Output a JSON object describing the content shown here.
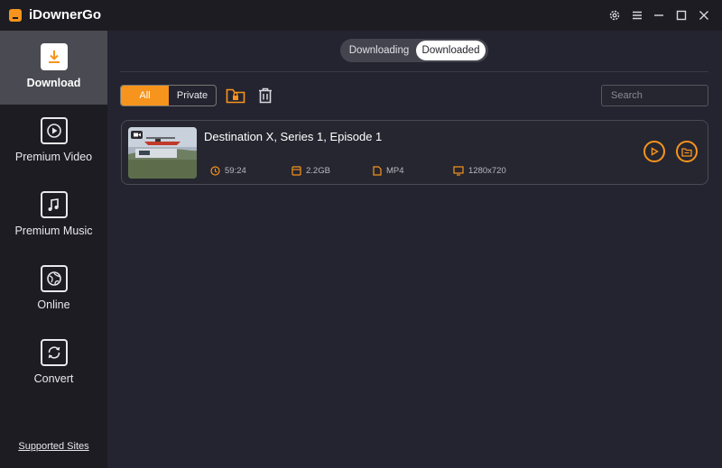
{
  "app": {
    "title": "iDownerGo"
  },
  "sidebar": {
    "items": [
      {
        "label": "Download",
        "icon": "download-icon",
        "active": true
      },
      {
        "label": "Premium Video",
        "icon": "play-icon",
        "active": false
      },
      {
        "label": "Premium Music",
        "icon": "music-icon",
        "active": false
      },
      {
        "label": "Online",
        "icon": "globe-icon",
        "active": false
      },
      {
        "label": "Convert",
        "icon": "convert-icon",
        "active": false
      }
    ],
    "footer_link": "Supported Sites"
  },
  "tabs": {
    "downloading": "Downloading",
    "downloaded": "Downloaded",
    "active": "Downloaded"
  },
  "filter": {
    "all": "All",
    "private": "Private",
    "active": "All"
  },
  "search": {
    "placeholder": "Search",
    "value": ""
  },
  "downloads": [
    {
      "title": "Destination X, Series 1, Episode 1",
      "duration": "59:24",
      "size": "2.2GB",
      "format": "MP4",
      "resolution": "1280x720"
    }
  ],
  "colors": {
    "accent": "#f7941d",
    "background": "#242430",
    "sidebar": "#1c1c22",
    "sidebar_active": "#4a4a52"
  }
}
